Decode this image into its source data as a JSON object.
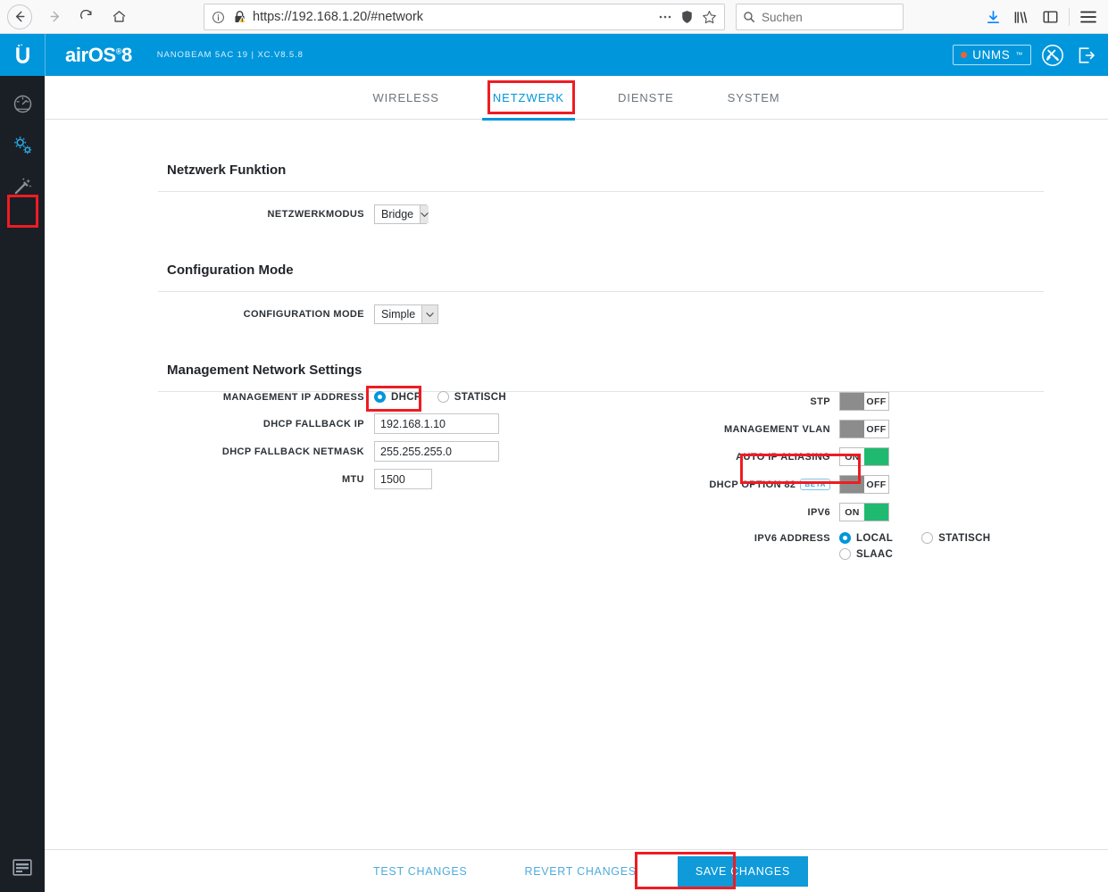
{
  "browser": {
    "url": "https://192.168.1.20/#network",
    "search_placeholder": "Suchen",
    "icons": {
      "back": "back-arrow-icon",
      "forward": "forward-arrow-icon",
      "reload": "reload-icon",
      "home": "home-icon",
      "info": "info-circle-icon",
      "lock": "insecure-lock-icon",
      "more": "more-dots-icon",
      "shield": "tracking-shield-icon",
      "bookmark": "star-icon",
      "search": "search-icon",
      "download": "download-icon",
      "library": "library-icon",
      "sidebar": "sidebar-icon",
      "menu": "hamburger-menu-icon"
    }
  },
  "header": {
    "logo": "ubiquiti-logo-icon",
    "brand_air": "air",
    "brand_os": "OS",
    "brand_sup": "®",
    "brand_version": "8",
    "device_info": "NANOBEAM 5AC 19 | XC.V8.5.8",
    "unms_label": "UNMS",
    "unms_sup": "™",
    "unms_dot_color": "#e8653a",
    "tools_icon": "tools-icon",
    "logout_icon": "logout-icon",
    "bg_color": "#0096dc"
  },
  "sidebar": {
    "items": [
      {
        "name": "dashboard",
        "icon": "dashboard-gauge-icon",
        "active": false
      },
      {
        "name": "settings",
        "icon": "gears-icon",
        "active": true
      },
      {
        "name": "tools",
        "icon": "magic-wand-icon",
        "active": false
      }
    ],
    "bottom_item": {
      "name": "console",
      "icon": "terminal-icon"
    },
    "bg_color": "#1a1e25",
    "active_color": "#2aabe4"
  },
  "tabs": [
    {
      "label": "WIRELESS",
      "active": false
    },
    {
      "label": "NETZWERK",
      "active": true
    },
    {
      "label": "DIENSTE",
      "active": false
    },
    {
      "label": "SYSTEM",
      "active": false
    }
  ],
  "sections": {
    "network_function": {
      "title": "Netzwerk Funktion",
      "field_label": "NETZWERKMODUS",
      "field_value": "Bridge"
    },
    "configuration_mode": {
      "title": "Configuration Mode",
      "field_label": "CONFIGURATION MODE",
      "field_value": "Simple"
    },
    "management": {
      "title": "Management Network Settings",
      "mgmt_ip_label": "MANAGEMENT IP ADDRESS",
      "mgmt_ip_option_dhcp": "DHCP",
      "mgmt_ip_option_static": "STATISCH",
      "mgmt_ip_selected": "DHCP",
      "fallback_ip_label": "DHCP FALLBACK IP",
      "fallback_ip_value": "192.168.1.10",
      "fallback_netmask_label": "DHCP FALLBACK NETMASK",
      "fallback_netmask_value": "255.255.255.0",
      "mtu_label": "MTU",
      "mtu_value": "1500",
      "toggles": [
        {
          "label": "STP",
          "state": "OFF",
          "beta": false
        },
        {
          "label": "MANAGEMENT VLAN",
          "state": "OFF",
          "beta": false
        },
        {
          "label": "AUTO IP ALIASING",
          "state": "ON",
          "beta": false
        },
        {
          "label": "DHCP OPTION 82",
          "state": "OFF",
          "beta": true,
          "beta_label": "BETA"
        },
        {
          "label": "IPV6",
          "state": "ON",
          "beta": false
        }
      ],
      "ipv6_address_label": "IPV6 ADDRESS",
      "ipv6_options": [
        {
          "label": "LOCAL",
          "selected": true
        },
        {
          "label": "STATISCH",
          "selected": false
        },
        {
          "label": "SLAAC",
          "selected": false
        }
      ]
    }
  },
  "footer": {
    "test_label": "TEST CHANGES",
    "revert_label": "REVERT CHANGES",
    "save_label": "SAVE CHANGES",
    "save_bg": "#0f9ada"
  },
  "highlights": {
    "color": "#ee1c23",
    "targets": [
      "sidebar-settings",
      "tab-netzwerk",
      "dhcp-radio",
      "ipv6-toggle",
      "save-changes"
    ]
  },
  "colors": {
    "brand_blue": "#0096dc",
    "toggle_green": "#1fba70",
    "toggle_grey": "#8c8c8c",
    "sidebar_dark": "#1a1e25",
    "highlight_red": "#ee1c23"
  }
}
